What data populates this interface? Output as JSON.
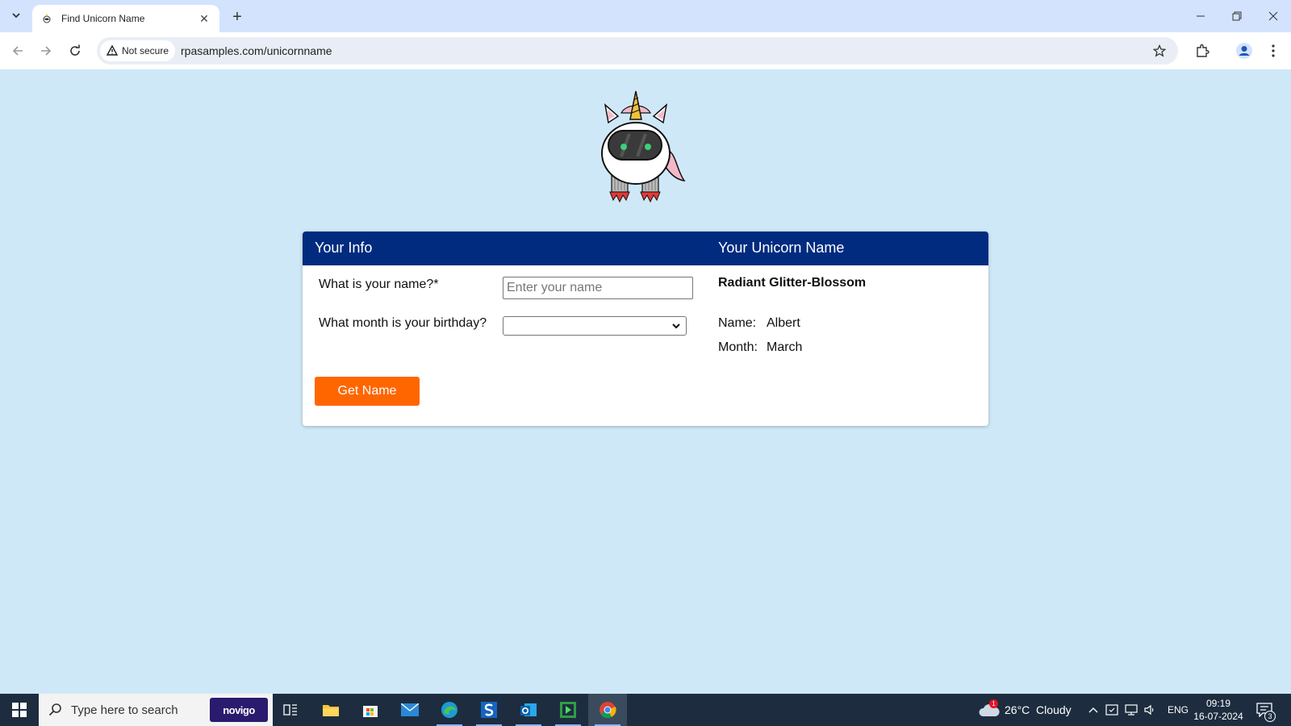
{
  "browser": {
    "tab_title": "Find Unicorn Name",
    "security_label": "Not secure",
    "url": "rpasamples.com/unicornname"
  },
  "card": {
    "left_header": "Your Info",
    "right_header": "Your Unicorn Name",
    "name_question": "What is your name?*",
    "name_placeholder": "Enter your name",
    "name_value": "",
    "month_question": "What month is your birthday?",
    "month_value": "",
    "button_label": "Get Name"
  },
  "result": {
    "unicorn_name": "Radiant Glitter-Blossom",
    "name_label": "Name:",
    "name_value": "Albert",
    "month_label": "Month:",
    "month_value": "March"
  },
  "taskbar": {
    "search_placeholder": "Type here to search",
    "novigo_label": "novigo",
    "weather_badge": "1",
    "weather": "26°C  Cloudy",
    "language": "ENG",
    "time": "09:19",
    "date": "16-07-2024",
    "notification_count": "3"
  }
}
